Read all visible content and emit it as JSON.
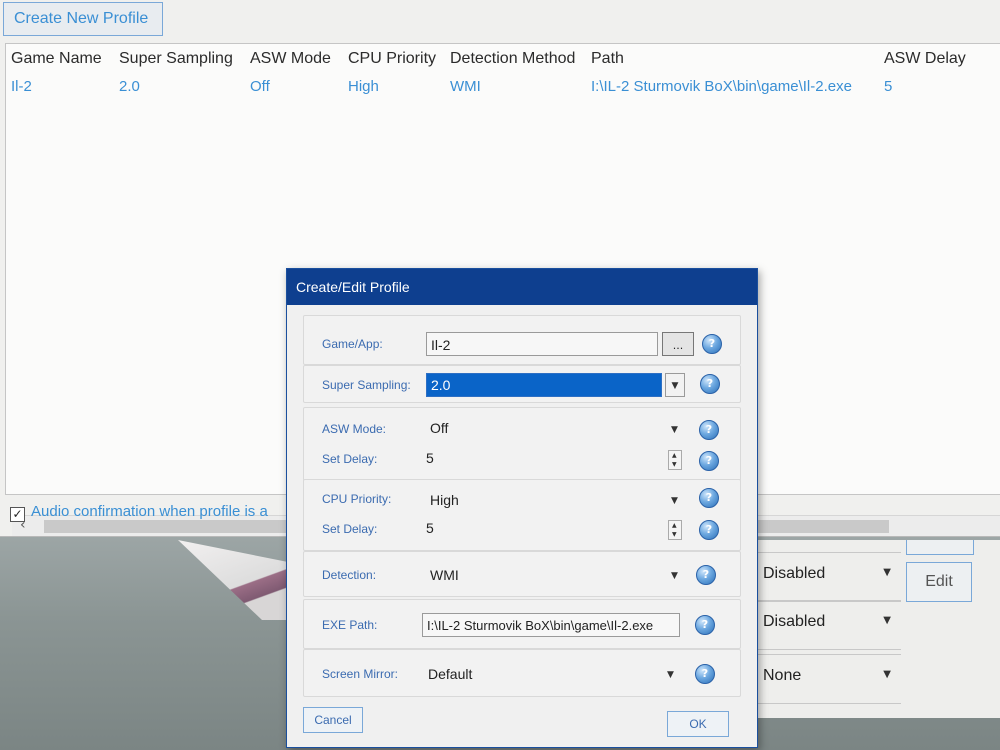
{
  "main": {
    "create_button": "Create New Profile",
    "columns": [
      "Game Name",
      "Super Sampling",
      "ASW Mode",
      "CPU Priority",
      "Detection Method",
      "Path",
      "ASW Delay"
    ],
    "rows": [
      [
        "Il-2",
        "2.0",
        "Off",
        "High",
        "WMI",
        "I:\\IL-2 Sturmovik BoX\\bin\\game\\Il-2.exe",
        "5"
      ]
    ],
    "audio_confirmation": "Audio confirmation when profile is a",
    "audio_checked": true
  },
  "background_panel": {
    "rows": [
      "Disabled",
      "Disabled",
      "None"
    ],
    "edit_button": "Edit"
  },
  "dialog": {
    "title": "Create/Edit Profile",
    "game_app_label": "Game/App:",
    "game_app_value": "Il-2",
    "browse_label": "...",
    "super_sampling_label": "Super Sampling:",
    "super_sampling_value": "2.0",
    "asw_mode_label": "ASW Mode:",
    "asw_mode_value": "Off",
    "asw_delay_label": "Set Delay:",
    "asw_delay_value": "5",
    "cpu_priority_label": "CPU Priority:",
    "cpu_priority_value": "High",
    "cpu_delay_label": "Set Delay:",
    "cpu_delay_value": "5",
    "detection_label": "Detection:",
    "detection_value": "WMI",
    "exe_path_label": "EXE Path:",
    "exe_path_value": "I:\\IL-2 Sturmovik BoX\\bin\\game\\Il-2.exe",
    "screen_mirror_label": "Screen Mirror:",
    "screen_mirror_value": "Default",
    "cancel_button": "Cancel",
    "ok_button": "OK"
  },
  "colors": {
    "accent": "#3a8fd4",
    "title_bar": "#0e3f8f",
    "selection": "#0a64c8"
  },
  "icons": {
    "help": "help-icon",
    "dropdown": "chevron-down-icon",
    "scroll_left": "chevron-left-icon"
  }
}
